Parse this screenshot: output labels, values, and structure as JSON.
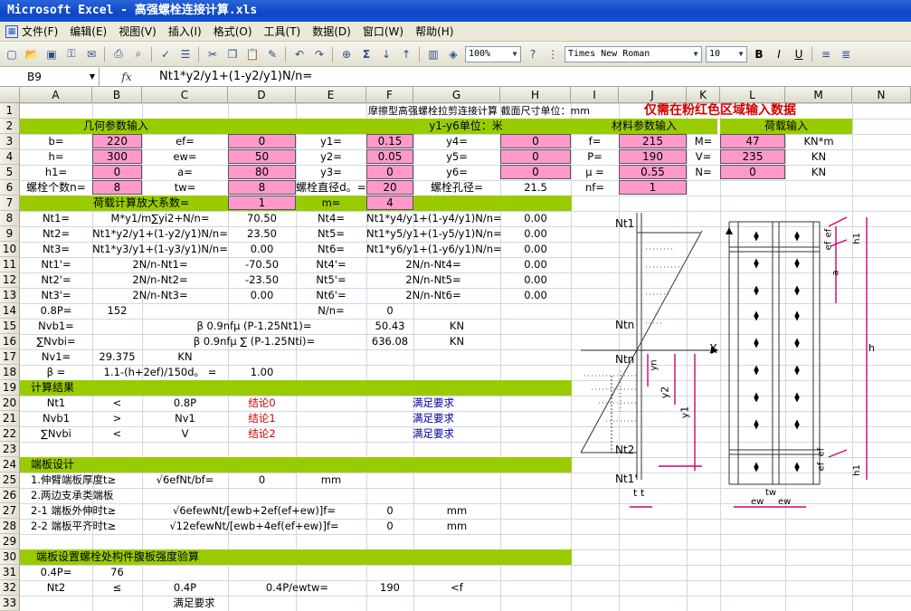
{
  "window": {
    "title": "Microsoft Excel - 高强螺栓连接计算.xls"
  },
  "menu": [
    "文件(F)",
    "编辑(E)",
    "视图(V)",
    "插入(I)",
    "格式(O)",
    "工具(T)",
    "数据(D)",
    "窗口(W)",
    "帮助(H)"
  ],
  "toolbar": {
    "zoom": "100%",
    "font": "Times New Roman",
    "size": "10",
    "bold": "B",
    "italic": "I",
    "underline": "U"
  },
  "formula_bar": {
    "cell_ref": "B9",
    "fx": "fx",
    "formula": "Nt1*y2/y1+(1-y2/y1)N/n="
  },
  "columns": [
    "A",
    "B",
    "C",
    "D",
    "E",
    "F",
    "G",
    "H",
    "I",
    "J",
    "K",
    "L",
    "M",
    "N"
  ],
  "rows": [
    "1",
    "2",
    "3",
    "4",
    "5",
    "6",
    "7",
    "8",
    "9",
    "10",
    "11",
    "12",
    "13",
    "14",
    "15",
    "16",
    "17",
    "18",
    "19",
    "20",
    "21",
    "22",
    "23",
    "24",
    "25",
    "26",
    "27",
    "28",
    "29",
    "30",
    "31",
    "32",
    "33"
  ],
  "sheet": {
    "r1_title": "摩擦型高强螺栓拉剪连接计算 截面尺寸单位：mm",
    "r1_note": "仅需在粉红色区域输入数据",
    "r2_geom": "几何参数输入",
    "r2_y": "y1-y6单位：米",
    "r2_mat": "材料参数输入",
    "r2_load": "荷载输入",
    "r3": {
      "a": "b=",
      "b": "220",
      "c": "ef=",
      "d": "0",
      "e": "y1=",
      "f": "0.15",
      "g": "y4=",
      "h": "0",
      "i": "f=",
      "j": "215",
      "k": "M=",
      "l": "47",
      "m": "KN*m"
    },
    "r4": {
      "a": "h=",
      "b": "300",
      "c": "ew=",
      "d": "50",
      "e": "y2=",
      "f": "0.05",
      "g": "y5=",
      "h": "0",
      "i": "P=",
      "j": "190",
      "k": "V=",
      "l": "235",
      "m": "KN"
    },
    "r5": {
      "a": "h1=",
      "b": "0",
      "c": "a=",
      "d": "80",
      "e": "y3=",
      "f": "0",
      "g": "y6=",
      "h": "0",
      "i": "μ =",
      "j": "0.55",
      "k": "N=",
      "l": "0",
      "m": "KN"
    },
    "r6": {
      "a": "螺栓个数n=",
      "b": "8",
      "c": "tw=",
      "d": "8",
      "e": "螺栓直径d。=",
      "f": "20",
      "g": "螺栓孔径=",
      "h": "21.5",
      "i": "nf=",
      "j": "1"
    },
    "r7": {
      "label": "荷载计算放大系数=",
      "d": "1",
      "e": "m=",
      "f": "4"
    },
    "r8": {
      "a": "Nt1=",
      "c": "M*y1/m∑yi2+N/n=",
      "d": "70.50",
      "e": "Nt4=",
      "g": "Nt1*y4/y1+(1-y4/y1)N/n=",
      "h": "0.00"
    },
    "r9": {
      "a": "Nt2=",
      "c": "Nt1*y2/y1+(1-y2/y1)N/n=",
      "d": "23.50",
      "e": "Nt5=",
      "g": "Nt1*y5/y1+(1-y5/y1)N/n=",
      "h": "0.00"
    },
    "r10": {
      "a": "Nt3=",
      "c": "Nt1*y3/y1+(1-y3/y1)N/n=",
      "d": "0.00",
      "e": "Nt6=",
      "g": "Nt1*y6/y1+(1-y6/y1)N/n=",
      "h": "0.00"
    },
    "r11": {
      "a": "Nt1'=",
      "c": "2N/n-Nt1=",
      "d": "-70.50",
      "e": "Nt4'=",
      "g": "2N/n-Nt4=",
      "h": "0.00"
    },
    "r12": {
      "a": "Nt2'=",
      "c": "2N/n-Nt2=",
      "d": "-23.50",
      "e": "Nt5'=",
      "g": "2N/n-Nt5=",
      "h": "0.00"
    },
    "r13": {
      "a": "Nt3'=",
      "c": "2N/n-Nt3=",
      "d": "0.00",
      "e": "Nt6'=",
      "g": "2N/n-Nt6=",
      "h": "0.00"
    },
    "r14": {
      "a": "0.8P=",
      "b": "152",
      "e": "N/n=",
      "f": "0"
    },
    "r15": {
      "a": "Nvb1=",
      "c": "β 0.9nfμ (P-1.25Nt1)=",
      "f": "50.43",
      "g": "KN"
    },
    "r16": {
      "a": "∑Nvbi=",
      "c": "β 0.9nfμ ∑ (P-1.25Nti)=",
      "f": "636.08",
      "g": "KN"
    },
    "r17": {
      "a": "Nv1=",
      "b": "29.375",
      "c": "KN"
    },
    "r18": {
      "a": "β =",
      "c": "1.1-(h+2ef)/150d。 =",
      "d": "1.00"
    },
    "r19": "计算结果",
    "r20": {
      "a": "Nt1",
      "b": "<",
      "c": "0.8P",
      "d": "结论0",
      "g": "满足要求"
    },
    "r21": {
      "a": "Nvb1",
      "b": ">",
      "c": "Nv1",
      "d": "结论1",
      "g": "满足要求"
    },
    "r22": {
      "a": "∑Nvbi",
      "b": "<",
      "c": "V",
      "d": "结论2",
      "g": "满足要求"
    },
    "r24": "端板设计",
    "r25": {
      "a": "1.伸臂端板厚度t≥",
      "c": "√6efNt/bf=",
      "d": "0",
      "e": "mm"
    },
    "r26": {
      "a": "2.两边支承类端板"
    },
    "r27": {
      "a": "2-1 端板外伸时t≥",
      "c": "√6efewNt/[ewb+2ef(ef+ew)]f=",
      "f": "0",
      "g": "mm"
    },
    "r28": {
      "a": "2-2 端板平齐时t≥",
      "c": "√12efewNt/[ewb+4ef(ef+ew)]f=",
      "f": "0",
      "g": "mm"
    },
    "r30": "端板设置螺栓处构件腹板强度验算",
    "r31": {
      "a": "0.4P=",
      "b": "76"
    },
    "r32": {
      "a": "Nt2",
      "b": "≤",
      "c": "0.4P",
      "e": "0.4P/ewtw=",
      "f": "190",
      "g": "<f"
    },
    "r33": {
      "c": "满足要求"
    }
  },
  "diagram": {
    "left": {
      "nt1": "Nt1",
      "dots1": "·",
      "ntn": "Ntn",
      "x": "X",
      "ntn2": "Ntn",
      "yn": "yn",
      "y2": "y2",
      "y1": "y1",
      "nt2": "Nt2",
      "nt1p": "Nt1'",
      "t": "t",
      "tt": "t"
    },
    "right": {
      "ef": "ef",
      "ef2": "ef",
      "h1": "h1",
      "a": "a",
      "h": "h",
      "ef3": "ef",
      "ef4": "ef",
      "h1b": "h1",
      "ew": "ew",
      "ew2": "ew",
      "tw": "tw"
    }
  }
}
